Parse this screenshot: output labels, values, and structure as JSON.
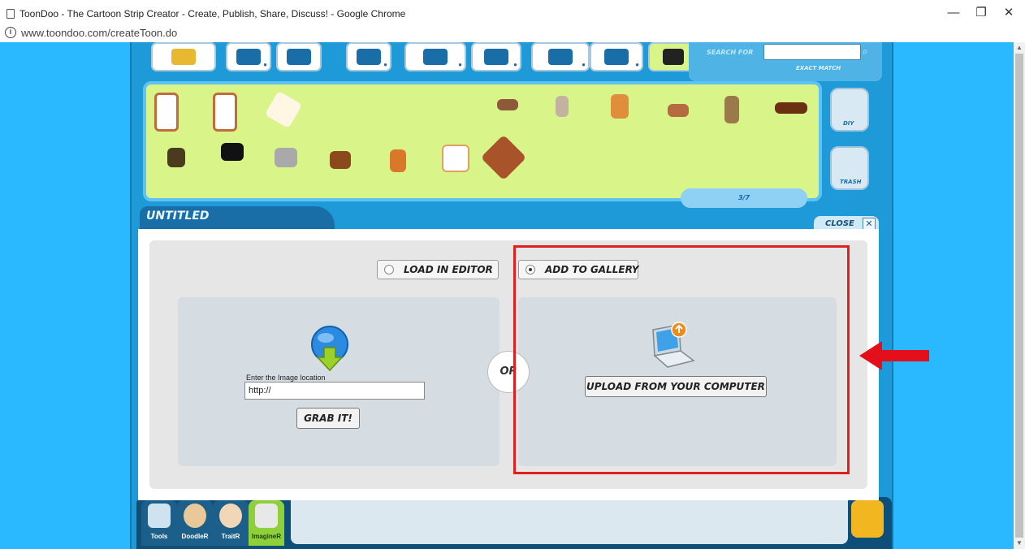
{
  "window": {
    "title": "ToonDoo - The Cartoon Strip Creator - Create, Publish, Share, Discuss! - Google Chrome",
    "minimize": "—",
    "restore": "❐",
    "close": "✕"
  },
  "urlbar": {
    "info_icon": "i",
    "url": "www.toondoo.com/createToon.do"
  },
  "toolbar": {
    "tabs": [
      "start-here",
      "characters",
      "scenes",
      "props",
      "speech",
      "special",
      "favorites",
      "imagine",
      "my-stuff"
    ],
    "search_label": "SEARCH FOR",
    "exact_match": "EXACT MATCH"
  },
  "clipart": {
    "page": "3/7",
    "diy": "DIY",
    "trash": "TRASH"
  },
  "canvas": {
    "title": "UNTITLED",
    "close_label": "CLOSE",
    "close_icon": "✕"
  },
  "dialog": {
    "load_in_editor": "LOAD IN EDITOR",
    "add_to_gallery": "ADD TO GALLERY",
    "image_location_label": "Enter the Image location",
    "image_url_value": "http://",
    "grab_button": "GRAB IT!",
    "or_label": "OR",
    "upload_button": "UPLOAD FROM YOUR COMPUTER"
  },
  "bottombar": {
    "tools": "Tools",
    "doodler": "DoodleR",
    "traitr": "TraitR",
    "imaginer": "ImagineR"
  },
  "colors": {
    "page_bg": "#2ab8ff",
    "app_bg": "#1e9ad8",
    "clip_panel": "#d9f58a",
    "highlight": "#e02020"
  }
}
